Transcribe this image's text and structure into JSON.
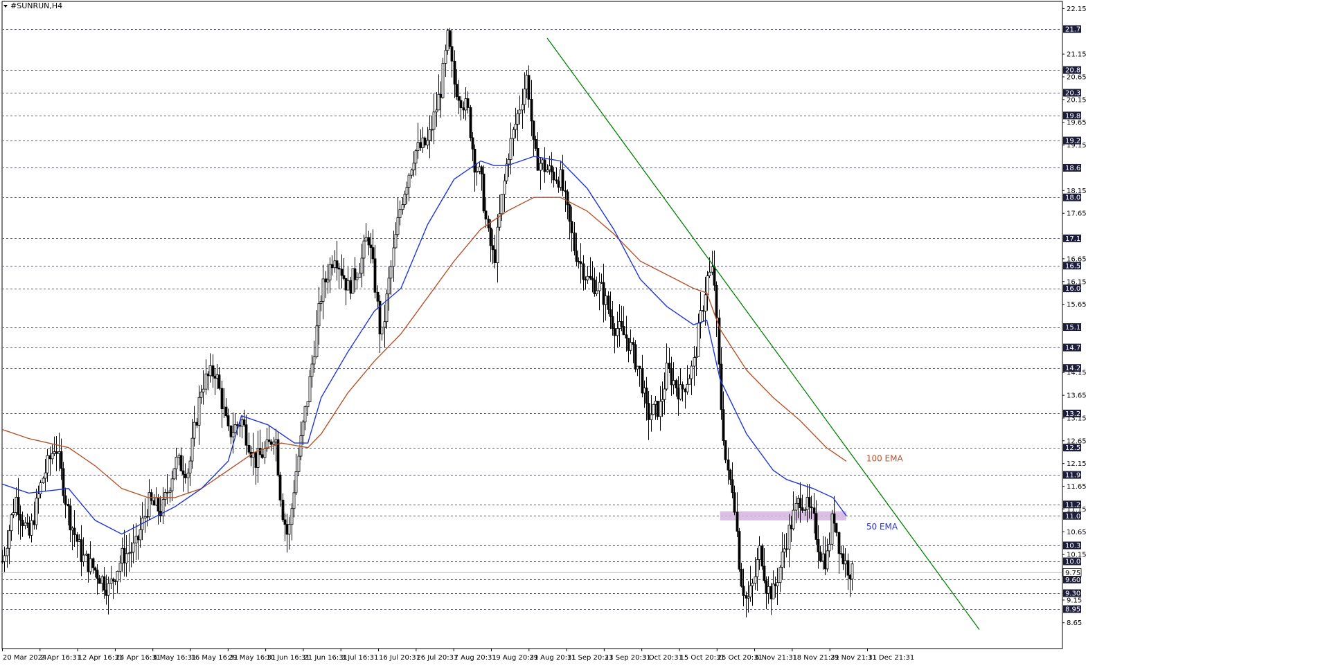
{
  "window": {
    "symbol": "#SUNRUN,H4"
  },
  "chart_data": {
    "type": "candlestick",
    "title": "#SUNRUN,H4",
    "ylim": [
      8.5,
      22.4
    ],
    "y_ticks": [
      "22.15",
      "21.70",
      "21.15",
      "20.80",
      "20.65",
      "20.30",
      "20.15",
      "19.80",
      "19.65",
      "19.25",
      "19.15",
      "18.65",
      "18.15",
      "18.00",
      "17.65",
      "17.10",
      "16.65",
      "16.50",
      "16.15",
      "16.00",
      "15.65",
      "15.15",
      "14.70",
      "14.25",
      "14.15",
      "13.65",
      "13.25",
      "13.15",
      "12.65",
      "12.50",
      "12.15",
      "11.90",
      "11.65",
      "11.25",
      "11.15",
      "11.00",
      "10.65",
      "10.35",
      "10.15",
      "10.00",
      "9.75",
      "9.60",
      "9.30",
      "9.15",
      "8.95",
      "8.65"
    ],
    "highlighted_levels": [
      "21.70",
      "20.80",
      "20.30",
      "19.80",
      "19.25",
      "18.65",
      "18.00",
      "17.10",
      "16.50",
      "16.00",
      "15.15",
      "14.70",
      "14.25",
      "13.25",
      "12.50",
      "11.90",
      "11.25",
      "11.00",
      "10.35",
      "10.00",
      "9.60",
      "9.30",
      "8.95"
    ],
    "current_price": "9.75",
    "x_ticks": [
      "20 Mar 2024",
      "2 Apr 16:31",
      "12 Apr 16:31",
      "24 Apr 16:31",
      "6 May 16:31",
      "16 May 16:31",
      "29 May 16:31",
      "10 Jun 16:31",
      "21 Jun 16:31",
      "3 Jul 16:31",
      "16 Jul 20:31",
      "26 Jul 20:31",
      "7 Aug 20:31",
      "19 Aug 20:31",
      "29 Aug 20:31",
      "11 Sep 20:31",
      "23 Sep 20:31",
      "3 Oct 20:31",
      "15 Oct 20:31",
      "25 Oct 20:31",
      "6 Nov 21:31",
      "18 Nov 21:31",
      "29 Nov 21:31",
      "11 Dec 21:31"
    ],
    "price_path": [
      [
        0,
        10.0
      ],
      [
        2,
        11.4
      ],
      [
        4,
        10.5
      ],
      [
        6,
        11.8
      ],
      [
        8,
        12.6
      ],
      [
        10,
        11.0
      ],
      [
        12,
        10.1
      ],
      [
        14,
        9.8
      ],
      [
        16,
        9.4
      ],
      [
        18,
        10.1
      ],
      [
        20,
        10.3
      ],
      [
        22,
        11.3
      ],
      [
        24,
        11.1
      ],
      [
        26,
        12.2
      ],
      [
        28,
        12.0
      ],
      [
        30,
        13.9
      ],
      [
        32,
        14.2
      ],
      [
        34,
        12.8
      ],
      [
        36,
        13.1
      ],
      [
        38,
        12.2
      ],
      [
        40,
        12.5
      ],
      [
        41,
        12.9
      ],
      [
        42,
        11.2
      ],
      [
        43,
        10.5
      ],
      [
        44,
        11.8
      ],
      [
        46,
        13.7
      ],
      [
        48,
        15.9
      ],
      [
        50,
        16.8
      ],
      [
        52,
        16.0
      ],
      [
        54,
        16.6
      ],
      [
        55,
        17.2
      ],
      [
        56,
        16.2
      ],
      [
        57,
        14.8
      ],
      [
        58,
        16.0
      ],
      [
        60,
        17.9
      ],
      [
        62,
        19.0
      ],
      [
        64,
        19.2
      ],
      [
        66,
        20.4
      ],
      [
        67,
        21.5
      ],
      [
        68,
        20.5
      ],
      [
        70,
        19.9
      ],
      [
        71,
        18.8
      ],
      [
        72,
        18.4
      ],
      [
        73,
        17.2
      ],
      [
        74,
        16.6
      ],
      [
        75,
        17.8
      ],
      [
        76,
        18.9
      ],
      [
        77,
        19.5
      ],
      [
        78,
        20.1
      ],
      [
        79,
        20.7
      ],
      [
        80,
        18.9
      ],
      [
        82,
        18.6
      ],
      [
        84,
        18.4
      ],
      [
        86,
        16.9
      ],
      [
        88,
        16.2
      ],
      [
        90,
        16.0
      ],
      [
        92,
        15.2
      ],
      [
        94,
        14.9
      ],
      [
        96,
        14.1
      ],
      [
        97,
        13.2
      ],
      [
        99,
        13.4
      ],
      [
        100,
        14.2
      ],
      [
        102,
        13.7
      ],
      [
        104,
        14.3
      ],
      [
        105,
        15.3
      ],
      [
        106,
        16.2
      ],
      [
        107,
        16.4
      ],
      [
        108,
        13.6
      ],
      [
        109,
        11.9
      ],
      [
        110,
        11.6
      ],
      [
        111,
        9.7
      ],
      [
        112,
        9.1
      ],
      [
        113,
        9.5
      ],
      [
        114,
        10.3
      ],
      [
        115,
        9.4
      ],
      [
        116,
        9.3
      ],
      [
        117,
        9.9
      ],
      [
        118,
        10.5
      ],
      [
        119,
        11.0
      ],
      [
        120,
        11.4
      ],
      [
        121,
        11.2
      ],
      [
        122,
        10.9
      ],
      [
        123,
        10.2
      ],
      [
        124,
        10.0
      ],
      [
        125,
        11.1
      ],
      [
        126,
        10.2
      ],
      [
        127,
        9.9
      ],
      [
        128,
        9.7
      ]
    ],
    "ema50_path": [
      [
        0,
        11.7
      ],
      [
        4,
        11.5
      ],
      [
        10,
        11.6
      ],
      [
        14,
        10.9
      ],
      [
        18,
        10.6
      ],
      [
        22,
        10.9
      ],
      [
        26,
        11.2
      ],
      [
        30,
        11.6
      ],
      [
        34,
        12.2
      ],
      [
        36,
        13.2
      ],
      [
        40,
        13.0
      ],
      [
        44,
        12.6
      ],
      [
        46,
        12.6
      ],
      [
        48,
        13.6
      ],
      [
        52,
        14.6
      ],
      [
        56,
        15.5
      ],
      [
        60,
        16.0
      ],
      [
        64,
        17.4
      ],
      [
        68,
        18.4
      ],
      [
        72,
        18.8
      ],
      [
        74,
        18.7
      ],
      [
        76,
        18.7
      ],
      [
        78,
        18.8
      ],
      [
        80,
        18.9
      ],
      [
        84,
        18.8
      ],
      [
        88,
        18.2
      ],
      [
        92,
        17.3
      ],
      [
        96,
        16.2
      ],
      [
        100,
        15.6
      ],
      [
        104,
        15.2
      ],
      [
        106,
        15.3
      ],
      [
        108,
        14.0
      ],
      [
        112,
        12.8
      ],
      [
        116,
        12.0
      ],
      [
        118,
        11.8
      ],
      [
        120,
        11.7
      ],
      [
        122,
        11.6
      ],
      [
        125,
        11.4
      ],
      [
        127,
        11.0
      ]
    ],
    "ema100_path": [
      [
        0,
        12.9
      ],
      [
        4,
        12.7
      ],
      [
        10,
        12.5
      ],
      [
        14,
        12.1
      ],
      [
        18,
        11.6
      ],
      [
        22,
        11.4
      ],
      [
        26,
        11.4
      ],
      [
        30,
        11.6
      ],
      [
        34,
        12.0
      ],
      [
        38,
        12.4
      ],
      [
        42,
        12.6
      ],
      [
        46,
        12.5
      ],
      [
        48,
        12.8
      ],
      [
        52,
        13.7
      ],
      [
        56,
        14.4
      ],
      [
        60,
        15.0
      ],
      [
        64,
        15.8
      ],
      [
        68,
        16.6
      ],
      [
        72,
        17.3
      ],
      [
        76,
        17.7
      ],
      [
        80,
        18.0
      ],
      [
        84,
        18.0
      ],
      [
        88,
        17.7
      ],
      [
        92,
        17.2
      ],
      [
        96,
        16.6
      ],
      [
        100,
        16.3
      ],
      [
        104,
        16.0
      ],
      [
        106,
        15.9
      ],
      [
        108,
        15.1
      ],
      [
        112,
        14.2
      ],
      [
        116,
        13.6
      ],
      [
        120,
        13.1
      ],
      [
        124,
        12.5
      ],
      [
        127,
        12.2
      ]
    ],
    "trendline": {
      "start": [
        82,
        21.5
      ],
      "end": [
        147,
        8.5
      ],
      "color": "#008000"
    },
    "zone": {
      "from": 10.9,
      "to": 11.1,
      "x_start": 108,
      "x_end": 127,
      "color": "#d3b5e1"
    },
    "annotations": [
      {
        "text": "100 EMA",
        "color": "#b5532a",
        "anchor_x": 130,
        "anchor_y": 12.2
      },
      {
        "text": "50 EMA",
        "color": "#2a35c9",
        "anchor_x": 130,
        "anchor_y": 10.7
      }
    ],
    "colors": {
      "ema50": "#1f35d6",
      "ema100": "#b5532a",
      "grid": "#5a5a8a",
      "tag_bg": "#1d1d3a",
      "current_tag_bg": "#ffffff"
    },
    "grid": true
  }
}
